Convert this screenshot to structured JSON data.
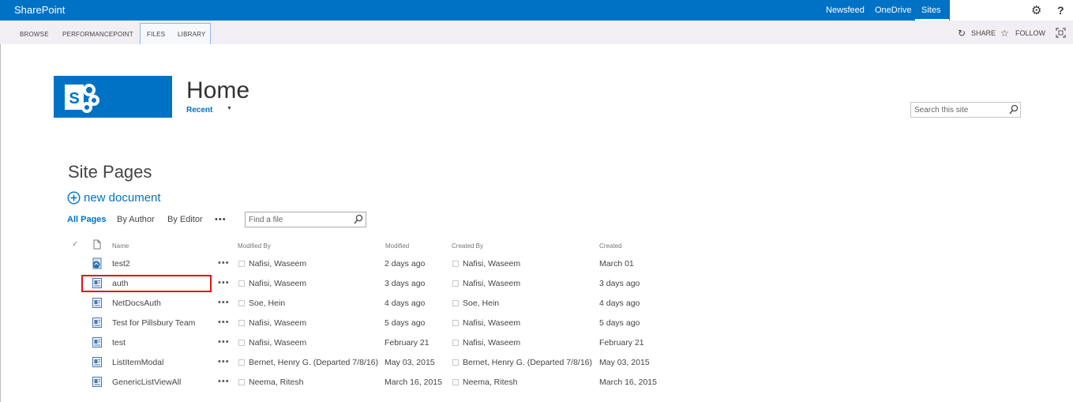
{
  "suitebar": {
    "brand": "SharePoint",
    "links": [
      "Newsfeed",
      "OneDrive",
      "Sites"
    ]
  },
  "ribbon": {
    "tabs": [
      "BROWSE",
      "PERFORMANCEPOINT",
      "FILES",
      "LIBRARY"
    ],
    "share_label": "SHARE",
    "follow_label": "FOLLOW"
  },
  "header": {
    "title": "Home",
    "recent_label": "Recent",
    "search_placeholder": "Search this site"
  },
  "library": {
    "title": "Site Pages",
    "new_document_label": "new document",
    "views": [
      "All Pages",
      "By Author",
      "By Editor"
    ],
    "view_more": "•••",
    "find_placeholder": "Find a file",
    "columns": [
      "Name",
      "Modified By",
      "Modified",
      "Created By",
      "Created"
    ],
    "rows": [
      {
        "name": "test2",
        "modified_by": "Nafisi, Waseem",
        "modified": "2 days ago",
        "created_by": "Nafisi, Waseem",
        "created": "March 01",
        "icon": "home-page-icon"
      },
      {
        "name": "auth",
        "modified_by": "Nafisi, Waseem",
        "modified": "3 days ago",
        "created_by": "Nafisi, Waseem",
        "created": "3 days ago",
        "icon": "page-icon"
      },
      {
        "name": "NetDocsAuth",
        "modified_by": "Soe, Hein",
        "modified": "4 days ago",
        "created_by": "Soe, Hein",
        "created": "4 days ago",
        "icon": "page-icon"
      },
      {
        "name": "Test for Pillsbury Team",
        "modified_by": "Nafisi, Waseem",
        "modified": "5 days ago",
        "created_by": "Nafisi, Waseem",
        "created": "5 days ago",
        "icon": "page-icon"
      },
      {
        "name": "test",
        "modified_by": "Nafisi, Waseem",
        "modified": "February 21",
        "created_by": "Nafisi, Waseem",
        "created": "February 21",
        "icon": "page-icon"
      },
      {
        "name": "ListItemModal",
        "modified_by": "Bernet, Henry G. (Departed 7/8/16)",
        "modified": "May 03, 2015",
        "created_by": "Bernet, Henry G. (Departed 7/8/16)",
        "created": "May 03, 2015",
        "icon": "page-icon"
      },
      {
        "name": "GenericListViewAll",
        "modified_by": "Neema, Ritesh",
        "modified": "March 16, 2015",
        "created_by": "Neema, Ritesh",
        "created": "March 16, 2015",
        "icon": "page-icon"
      }
    ],
    "row_menu": "•••"
  },
  "colors": {
    "brand_blue": "#0072c6",
    "ribbon_bg": "#f1eff4",
    "highlight_red": "#e0151b"
  }
}
